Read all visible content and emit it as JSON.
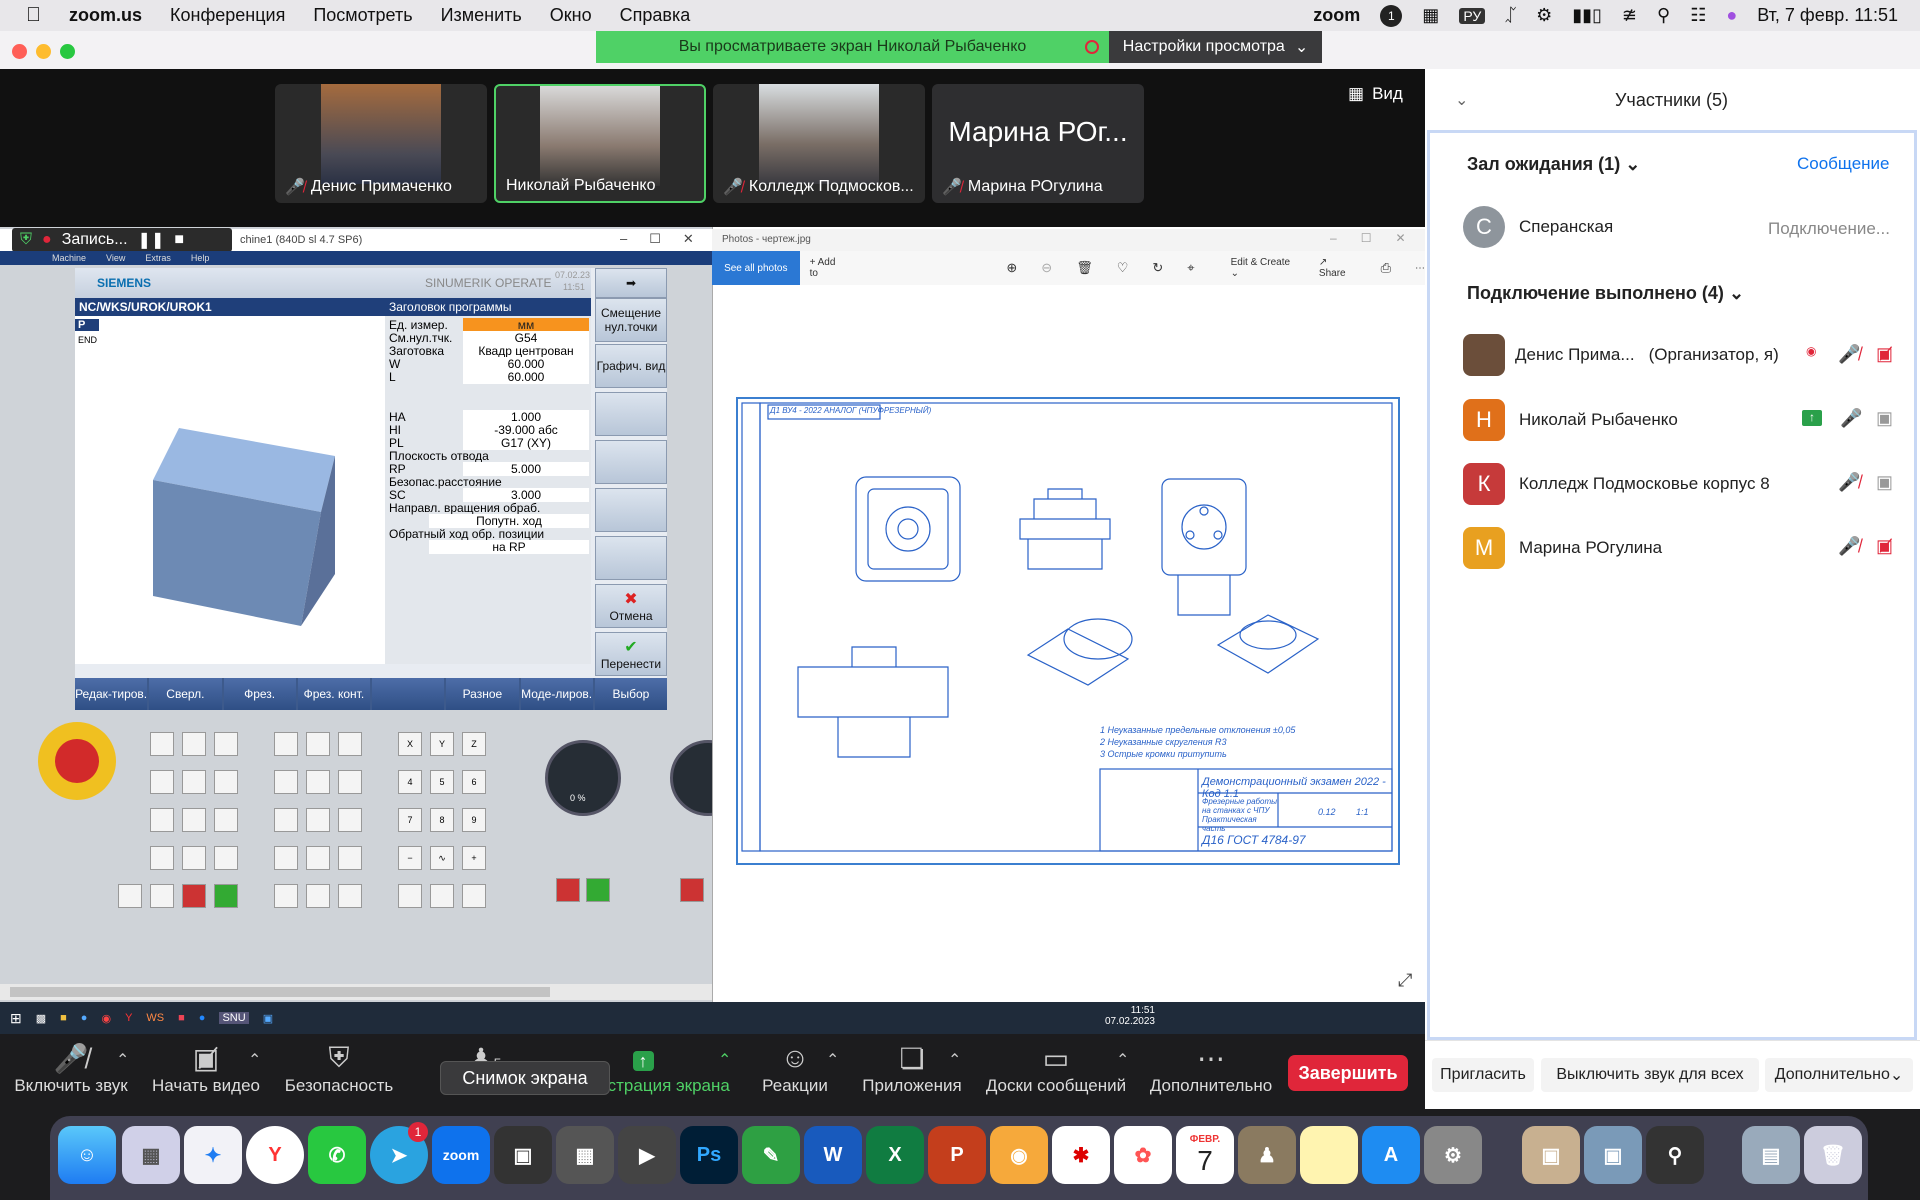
{
  "menubar": {
    "app": "zoom.us",
    "items": [
      "Конференция",
      "Посмотреть",
      "Изменить",
      "Окно",
      "Справка"
    ],
    "right_app": "zoom",
    "lang": "РУ",
    "datetime": "Вт, 7 февр.  11:51",
    "badge": "1"
  },
  "banner": {
    "viewing": "Вы просматриваете экран Николай Рыбаченко",
    "settings": "Настройки просмотра"
  },
  "videos": [
    {
      "name": "Денис Примаченко",
      "muted": true
    },
    {
      "name": "Николай Рыбаченко",
      "muted": false
    },
    {
      "name": "Колледж Подмосков...",
      "muted": true
    },
    {
      "name": "Марина РОгулина",
      "muted": true,
      "big": "Марина РОг..."
    }
  ],
  "view_button": "Вид",
  "recording": "Запись...",
  "sinumerik": {
    "title": "chine1 (840D sl 4.7 SP6)",
    "menu": [
      "Machine",
      "View",
      "Extras",
      "Help"
    ],
    "brand": "SIEMENS",
    "product": "SINUMERIK OPERATE",
    "date": "07.02.23",
    "time": "11:51",
    "path": "NC/WKS/UROK/UROK1",
    "header": "Заголовок программы",
    "tree": [
      "P",
      "END"
    ],
    "params": [
      {
        "k": "Ед. измер.",
        "v": "мм",
        "hl": true
      },
      {
        "k": "См.нул.тчк.",
        "v": "G54"
      },
      {
        "k": "Заготовка",
        "v": "Квадр центрован"
      },
      {
        "k": "W",
        "v": "60.000"
      },
      {
        "k": "L",
        "v": "60.000"
      },
      {
        "k": "HA",
        "v": "1.000"
      },
      {
        "k": "HI",
        "v": "-39.000 абс"
      },
      {
        "k": "PL",
        "v": "G17 (XY)"
      },
      {
        "k": "Плоскость отвода",
        "v": ""
      },
      {
        "k": "RP",
        "v": "5.000"
      },
      {
        "k": "Безопас.расстояние",
        "v": ""
      },
      {
        "k": "SC",
        "v": "3.000"
      },
      {
        "k": "Направл. вращения обраб.",
        "v": ""
      },
      {
        "k": "",
        "v": "Попутн. ход"
      },
      {
        "k": "Обратный ход обр. позиции",
        "v": ""
      },
      {
        "k": "",
        "v": "на RP"
      }
    ],
    "softkeys": [
      "Смещение нул.точки",
      "Графич. вид",
      "",
      "",
      "",
      "",
      "Отмена",
      "Перенести"
    ],
    "hbar": [
      "Редак-тиров.",
      "Сверл.",
      "Фрез.",
      "Фрез. конт.",
      "",
      "Разное",
      "Моде-лиров.",
      "Выбор"
    ],
    "keys_xyz": [
      "X",
      "Y",
      "Z",
      "4",
      "5",
      "6",
      "7",
      "8",
      "9",
      "−",
      "∿",
      "+"
    ],
    "knob_pct": "0 %"
  },
  "photos": {
    "title": "Photos - чертеж.jpg",
    "see_all": "See all photos",
    "add_to": "Add to",
    "edit": "Edit & Create",
    "share": "Share",
    "drawing": {
      "top_label": "Д1 ВУ4 - 2022 АНАЛОГ (ЧПУФРЕЗЕРНЫЙ)",
      "notes": [
        "1 Неуказанные предельные отклонения ±0,05",
        "2 Неуказанные скругления R3",
        "3 Острые кромки притупить"
      ],
      "exam": "Демонстрационный экзамен 2022 - Код 1.1",
      "desc": "Фрезерные работы на станках с ЧПУ Практическая часть",
      "material": "Д16 ГОСТ 4784-97",
      "scale": "1:1",
      "mass": "0.12"
    }
  },
  "taskbar": {
    "time": "11:51",
    "date": "07.02.2023"
  },
  "participants": {
    "title": "Участники (5)",
    "waiting": "Зал ожидания (1)",
    "message": "Сообщение",
    "waiting_user": "Сперанская",
    "connecting": "Подключение...",
    "connected": "Подключение выполнено (4)",
    "list": [
      {
        "initial": "Д",
        "name": "Денис Прима...",
        "role": "(Организатор, я)",
        "color": "#6b4e3a"
      },
      {
        "initial": "Н",
        "name": "Николай Рыбаченко",
        "role": "",
        "color": "#e0701a"
      },
      {
        "initial": "К",
        "name": "Колледж Подмосковье корпус 8",
        "role": "",
        "color": "#c63a3a"
      },
      {
        "initial": "М",
        "name": "Марина РОгулина",
        "role": "",
        "color": "#e8a020"
      }
    ],
    "invite": "Пригласить",
    "mute_all": "Выключить звук для всех",
    "more": "Дополнительно"
  },
  "toolbar": {
    "unmute": "Включить звук",
    "start_video": "Начать видео",
    "security": "Безопасность",
    "participants_count": "5",
    "share": "Демонстрация экрана",
    "reactions": "Реакции",
    "apps": "Приложения",
    "whiteboards": "Доски сообщений",
    "more": "Дополнительно",
    "end": "Завершить",
    "tooltip": "Снимок экрана"
  },
  "dock": {
    "telegram_badge": "1",
    "calendar_month": "ФЕВР.",
    "calendar_day": "7"
  },
  "colors": {
    "zoom_green": "#4fd166",
    "end_red": "#e0263a",
    "zoom_blue": "#0e72ed",
    "drawing_blue": "#2a62c8"
  }
}
